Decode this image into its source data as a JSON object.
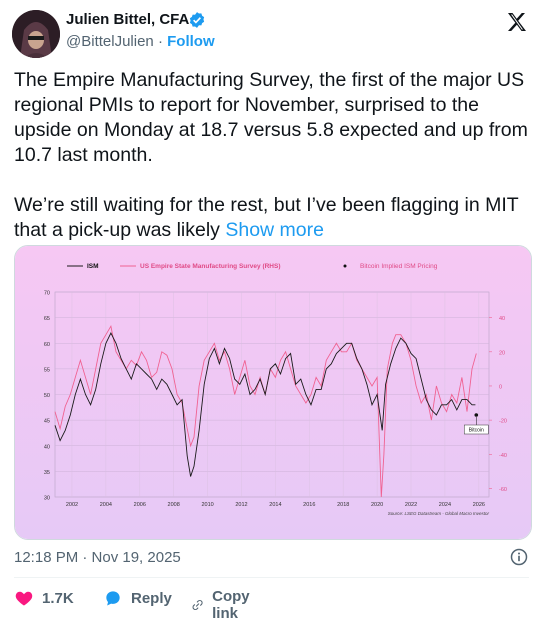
{
  "author": {
    "name": "Julien Bittel, CFA",
    "handle": "@BittelJulien",
    "separator": "·",
    "follow_label": "Follow"
  },
  "tweet": {
    "text": "The Empire Manufacturing Survey, the first of the major US regional PMIs to report for November, surprised to the upside on Monday at 18.7 versus 5.8 expected and up from 10.7 last month.\n\nWe’re still waiting for the rest, but I’ve been flagging in MIT that a pick-up was likely ",
    "show_more": "Show more"
  },
  "timestamp": "12:18 PM · Nov 19, 2025",
  "actions": {
    "likes": "1.7K",
    "reply_label": "Reply",
    "copy_link_label": "Copy link"
  },
  "icons": {
    "verified": "verified-badge-icon",
    "x_logo": "x-logo-icon",
    "info": "info-icon",
    "heart": "heart-icon",
    "reply": "reply-icon",
    "link": "link-icon"
  },
  "colors": {
    "accent": "#1d9bf0",
    "like": "#f91880",
    "ism_line": "#1a1a1a",
    "empire_line": "#f06292",
    "chart_bg_top": "#f6c8f3",
    "chart_bg_bottom": "#e8c8f5"
  },
  "chart_data": {
    "type": "line",
    "legend": [
      "ISM",
      "US Empire State Manufacturing Survey (RHS)",
      "Bitcoin Implied ISM Pricing"
    ],
    "legend_placement": "top",
    "annotation": "Bitcoin",
    "source": "Source: LSEG Datastream - Global Macro Investor",
    "x_ticks": [
      "2002",
      "2004",
      "2006",
      "2008",
      "2010",
      "2012",
      "2014",
      "2016",
      "2018",
      "2020",
      "2022",
      "2024",
      "2026"
    ],
    "y_left_ticks": [
      "30",
      "35",
      "40",
      "45",
      "50",
      "55",
      "60",
      "65",
      "70"
    ],
    "y_left_range": [
      30,
      70
    ],
    "y_right_ticks": [
      "-60",
      "-40",
      "-20",
      "0",
      "20",
      "40"
    ],
    "y_right_range": [
      -65,
      55
    ],
    "grid": true,
    "series": [
      {
        "name": "ISM",
        "axis": "left",
        "x": [
          2001.0,
          2001.3,
          2001.6,
          2001.9,
          2002.2,
          2002.5,
          2002.8,
          2003.1,
          2003.4,
          2003.7,
          2004.0,
          2004.3,
          2004.6,
          2004.9,
          2005.2,
          2005.5,
          2005.8,
          2006.1,
          2006.4,
          2006.7,
          2007.0,
          2007.3,
          2007.6,
          2007.9,
          2008.2,
          2008.5,
          2008.8,
          2009.0,
          2009.2,
          2009.5,
          2009.8,
          2010.1,
          2010.4,
          2010.7,
          2011.0,
          2011.3,
          2011.6,
          2011.9,
          2012.2,
          2012.5,
          2012.8,
          2013.1,
          2013.4,
          2013.7,
          2014.0,
          2014.3,
          2014.6,
          2014.9,
          2015.2,
          2015.5,
          2015.8,
          2016.1,
          2016.4,
          2016.7,
          2017.0,
          2017.3,
          2017.6,
          2017.9,
          2018.2,
          2018.5,
          2018.8,
          2019.1,
          2019.4,
          2019.7,
          2020.0,
          2020.3,
          2020.5,
          2020.8,
          2021.1,
          2021.4,
          2021.7,
          2022.0,
          2022.3,
          2022.6,
          2022.9,
          2023.2,
          2023.5,
          2023.8,
          2024.1,
          2024.4,
          2024.7,
          2025.0,
          2025.3,
          2025.6,
          2025.8
        ],
        "values": [
          44,
          41,
          43,
          46,
          50,
          53,
          50,
          48,
          51,
          56,
          60,
          62,
          60,
          57,
          55,
          53,
          56,
          55,
          54,
          53,
          51,
          53,
          52,
          50,
          48,
          49,
          38,
          34,
          36,
          43,
          52,
          57,
          59,
          56,
          59,
          57,
          53,
          52,
          54,
          50,
          51,
          53,
          50,
          55,
          56,
          54,
          57,
          58,
          52,
          53,
          50,
          48,
          51,
          51,
          55,
          56,
          58,
          59,
          60,
          60,
          57,
          55,
          52,
          48,
          50,
          43,
          52,
          56,
          59,
          61,
          60,
          58,
          57,
          53,
          49,
          47,
          46,
          48,
          48,
          49,
          47,
          49,
          49,
          48,
          48
        ]
      },
      {
        "name": "US Empire State Manufacturing Survey (RHS)",
        "axis": "right",
        "x": [
          2001.0,
          2001.3,
          2001.6,
          2001.9,
          2002.2,
          2002.5,
          2002.8,
          2003.1,
          2003.4,
          2003.7,
          2004.0,
          2004.3,
          2004.6,
          2004.9,
          2005.2,
          2005.5,
          2005.8,
          2006.1,
          2006.4,
          2006.7,
          2007.0,
          2007.3,
          2007.6,
          2007.9,
          2008.2,
          2008.5,
          2008.8,
          2009.0,
          2009.2,
          2009.5,
          2009.8,
          2010.1,
          2010.4,
          2010.7,
          2011.0,
          2011.3,
          2011.6,
          2011.9,
          2012.2,
          2012.5,
          2012.8,
          2013.1,
          2013.4,
          2013.7,
          2014.0,
          2014.3,
          2014.6,
          2014.9,
          2015.2,
          2015.5,
          2015.8,
          2016.1,
          2016.4,
          2016.7,
          2017.0,
          2017.3,
          2017.6,
          2017.9,
          2018.2,
          2018.5,
          2018.8,
          2019.1,
          2019.4,
          2019.7,
          2020.0,
          2020.25,
          2020.4,
          2020.6,
          2020.9,
          2021.1,
          2021.4,
          2021.7,
          2022.0,
          2022.3,
          2022.6,
          2022.9,
          2023.2,
          2023.5,
          2023.8,
          2024.1,
          2024.4,
          2024.7,
          2025.0,
          2025.3,
          2025.6,
          2025.85
        ],
        "values": [
          -15,
          -25,
          -12,
          -5,
          5,
          15,
          5,
          -5,
          10,
          25,
          30,
          35,
          20,
          15,
          10,
          15,
          12,
          20,
          15,
          5,
          8,
          20,
          18,
          10,
          -5,
          -10,
          -25,
          -35,
          -30,
          0,
          15,
          20,
          25,
          15,
          20,
          10,
          -5,
          5,
          15,
          0,
          -5,
          5,
          -5,
          10,
          5,
          15,
          20,
          10,
          0,
          -5,
          -10,
          -5,
          5,
          0,
          15,
          20,
          25,
          20,
          20,
          25,
          15,
          10,
          5,
          0,
          5,
          -65,
          -40,
          10,
          25,
          30,
          30,
          25,
          15,
          0,
          -10,
          -5,
          -20,
          0,
          -10,
          -15,
          -5,
          -10,
          5,
          -15,
          10,
          19
        ]
      }
    ],
    "bitcoin_point": {
      "x": 2025.85,
      "y": 46
    }
  }
}
